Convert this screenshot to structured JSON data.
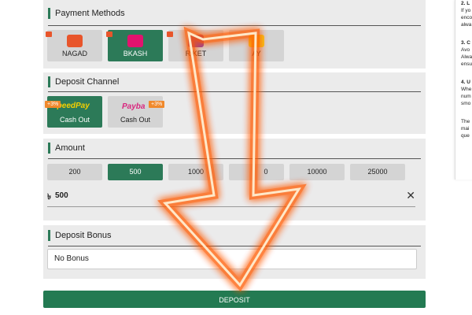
{
  "payment": {
    "title": "Payment Methods",
    "methods": [
      {
        "label": "NAGAD",
        "icon": "nagad-logo-icon",
        "active": false
      },
      {
        "label": "BKASH",
        "icon": "bkash-logo-icon",
        "active": true
      },
      {
        "label": "ROCKET",
        "shown": "R     KET",
        "icon": "rocket-logo-icon",
        "active": false
      },
      {
        "label": "UPAY",
        "shown": "AY",
        "icon": "upay-logo-icon",
        "active": false
      }
    ]
  },
  "channel": {
    "title": "Deposit Channel",
    "options": [
      {
        "label": "Cash Out",
        "logo": "SpeedPay",
        "badge": "+3%",
        "active": true
      },
      {
        "label": "Cash Out",
        "logo": "Payba",
        "badge": "+3%",
        "active": false
      }
    ]
  },
  "amount": {
    "title": "Amount",
    "options": [
      "200",
      "500",
      "1000",
      "5000",
      "10000",
      "25000"
    ],
    "shown": [
      "200",
      "500",
      "1000",
      "0",
      "10000",
      "25000"
    ],
    "selected": "500",
    "currency_symbol": "৳",
    "value": "500"
  },
  "bonus": {
    "title": "Deposit Bonus",
    "selected": "No Bonus"
  },
  "deposit_label": "DEPOSIT",
  "sidebar": {
    "lines": [
      "2. L",
      "If yo",
      "enco",
      "alwa",
      "",
      "3. C",
      "Avo",
      "Alwa",
      "ensu",
      "",
      "4. U",
      "Whe",
      "num",
      "smo",
      "",
      "The",
      "mai",
      "que"
    ]
  },
  "colors": {
    "accent": "#2c7a58",
    "button": "#237a52",
    "panel": "#ebebeb",
    "tile": "#d4d4d4",
    "arrow_glow": "#ff6a10",
    "badge": "#f0892c"
  }
}
